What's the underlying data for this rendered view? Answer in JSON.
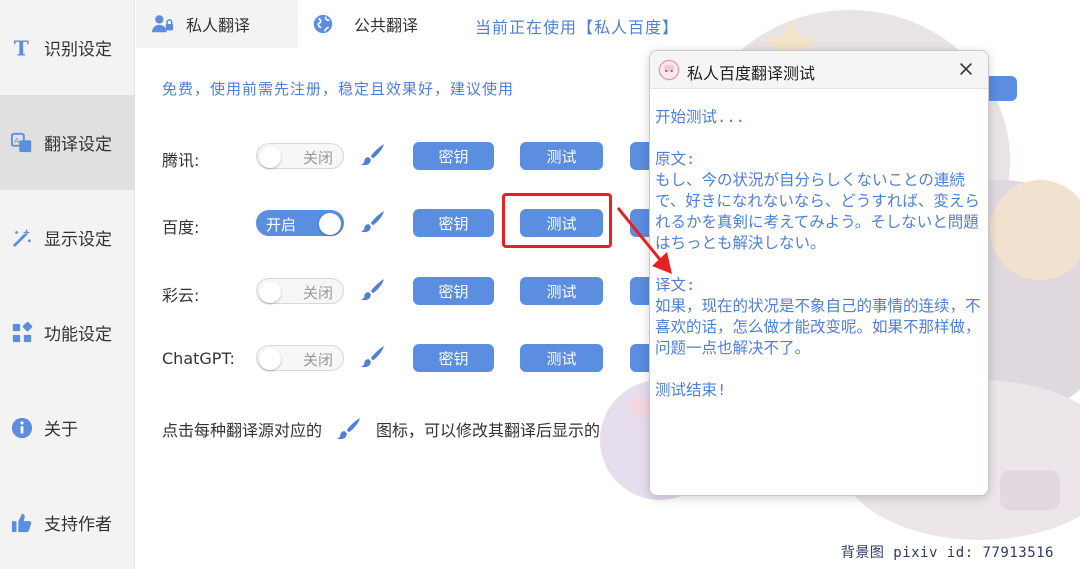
{
  "sidebar": {
    "items": [
      {
        "label": "识别设定",
        "icon": "text-t-icon"
      },
      {
        "label": "翻译设定",
        "icon": "translate-icon"
      },
      {
        "label": "显示设定",
        "icon": "magic-wand-icon"
      },
      {
        "label": "功能设定",
        "icon": "apps-grid-icon"
      },
      {
        "label": "关于",
        "icon": "info-icon"
      },
      {
        "label": "支持作者",
        "icon": "thumbs-up-icon"
      }
    ]
  },
  "tabs": [
    {
      "label": "私人翻译",
      "icon": "user-lock-icon"
    },
    {
      "label": "公共翻译",
      "icon": "globe-icon"
    }
  ],
  "current_using": "当前正在使用【私人百度】",
  "notice": "免费，使用前需先注册，稳定且效果好，建议使用",
  "engines": [
    {
      "label": "腾讯:",
      "toggle": "关闭",
      "on": false
    },
    {
      "label": "百度:",
      "toggle": "开启",
      "on": true
    },
    {
      "label": "彩云:",
      "toggle": "关闭",
      "on": false
    },
    {
      "label": "ChatGPT:",
      "toggle": "关闭",
      "on": false
    }
  ],
  "buttons": {
    "key_label": "密钥",
    "test_label": "测试"
  },
  "hint": {
    "before": "点击每种翻译源对应的",
    "after": "图标，可以修改其翻译后显示的"
  },
  "credit": "背景图 pixiv id: 77913516",
  "dialog": {
    "title": "私人百度翻译测试",
    "start": "开始测试...",
    "source_label": "原文:",
    "source_text": "もし、今の状況が自分らしくないことの連続で、好きになれないなら、どうすれば、変えられるかを真剣に考えてみよう。そしないと問題はちっとも解決しない。",
    "translation_label": "译文:",
    "translation_text": "如果，现在的状况是不象自己的事情的连续，不喜欢的话，怎么做才能改变呢。如果不那样做，问题一点也解决不了。",
    "end": "测试结束!"
  },
  "colors": {
    "accent": "#5b8de0",
    "text_blue": "#4f7fd6",
    "sidebar_bg": "#f3f3f3",
    "sidebar_active": "#e0e0e0",
    "highlight_red": "#e52222"
  }
}
